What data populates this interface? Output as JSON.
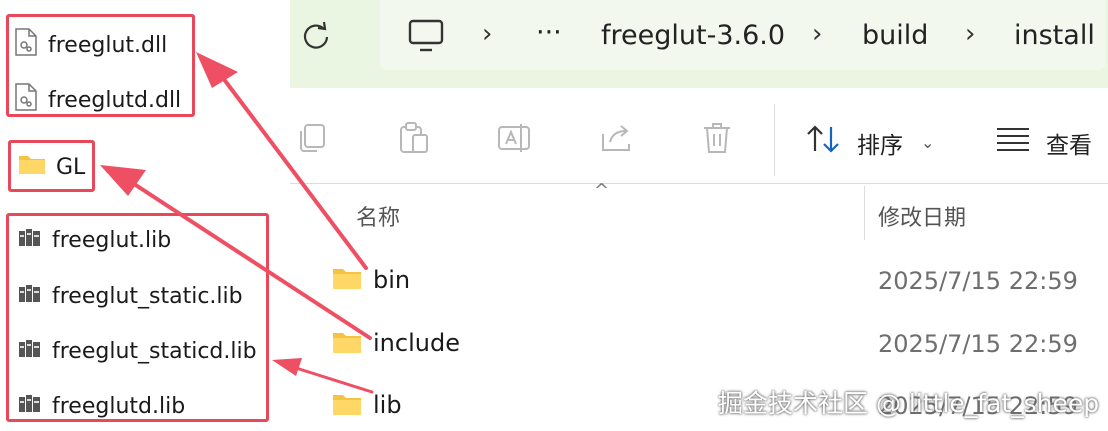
{
  "callouts": {
    "dll_files": [
      "freeglut.dll",
      "freeglutd.dll"
    ],
    "include_folder": "GL",
    "lib_files": [
      "freeglut.lib",
      "freeglut_static.lib",
      "freeglut_staticd.lib",
      "freeglutd.lib"
    ]
  },
  "explorer": {
    "breadcrumb": {
      "overflow": "···",
      "items": [
        "freeglut-3.6.0",
        "build",
        "install"
      ]
    },
    "toolbar": {
      "sort_label": "排序",
      "view_label": "查看"
    },
    "columns": {
      "name": "名称",
      "modified": "修改日期"
    },
    "rows": [
      {
        "name": "bin",
        "modified": "2025/7/15 22:59"
      },
      {
        "name": "include",
        "modified": "2025/7/15 22:59"
      },
      {
        "name": "lib",
        "modified": "2025/7/15 22:59"
      }
    ]
  },
  "watermark": "掘金技术社区 @ little_fat_sheep",
  "colors": {
    "annotation_red": "#e8485a",
    "address_bar_bg": "#eaf5e2",
    "folder_yellow": "#f5c242"
  },
  "icons": [
    "refresh-icon",
    "computer-icon",
    "copy-icon",
    "paste-icon",
    "rename-icon",
    "share-icon",
    "delete-icon",
    "sort-icon",
    "view-icon",
    "folder-icon",
    "dll-file-icon",
    "lib-file-icon"
  ]
}
